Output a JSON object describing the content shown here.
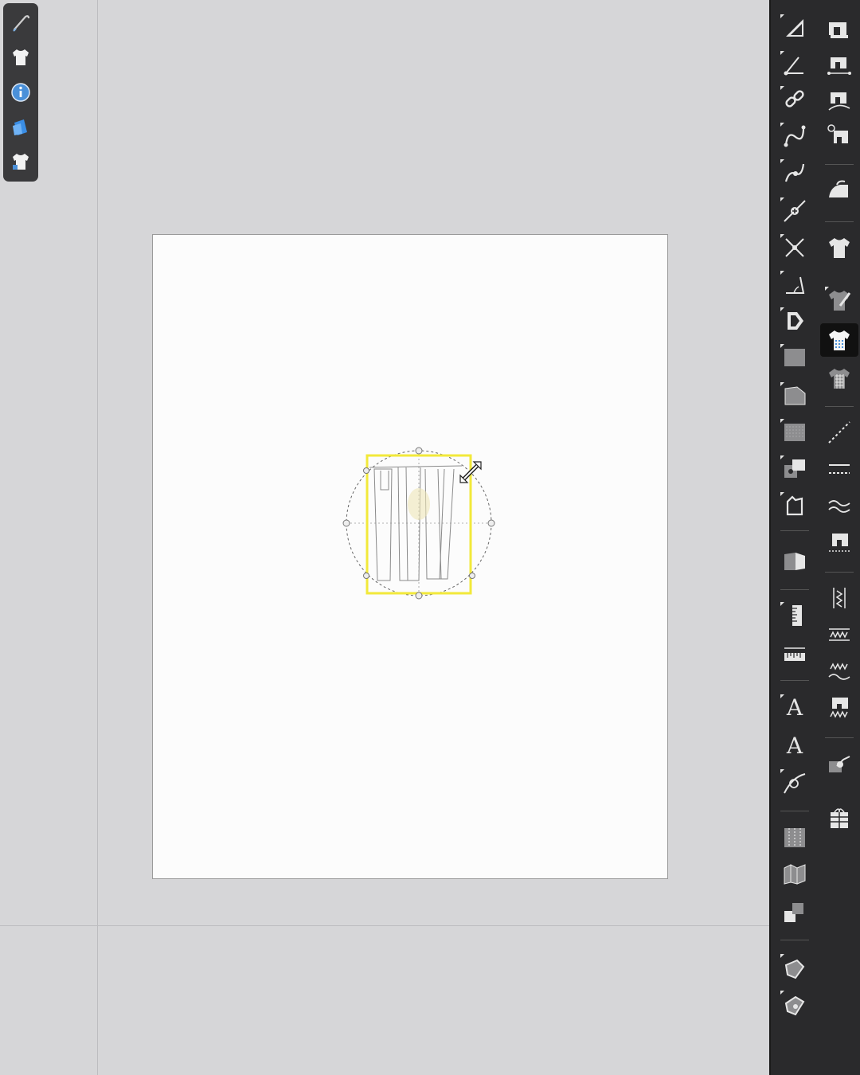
{
  "left_palette": {
    "tools": [
      {
        "icon": "needle-icon"
      },
      {
        "icon": "tshirt-icon"
      },
      {
        "icon": "info-icon"
      },
      {
        "icon": "fabric-swatch-icon"
      },
      {
        "icon": "garment-library-icon"
      }
    ]
  },
  "right_toolbar": {
    "column_a": [
      {
        "icon": "triangle-ruler-icon"
      },
      {
        "icon": "angle-point-icon"
      },
      {
        "icon": "link-icon"
      },
      {
        "icon": "curve-icon"
      },
      {
        "icon": "curve-point-icon"
      },
      {
        "icon": "add-point-icon"
      },
      {
        "icon": "intersect-icon"
      },
      {
        "icon": "angle-measure-icon"
      },
      {
        "icon": "rotate-piece-icon"
      },
      {
        "icon": "rectangle-piece-icon"
      },
      {
        "icon": "polygon-piece-icon"
      },
      {
        "icon": "textured-piece-icon"
      },
      {
        "icon": "overlap-pieces-icon"
      },
      {
        "icon": "notch-piece-icon"
      },
      {
        "icon": "fold-piece-icon"
      },
      {
        "icon": "vertical-ruler-icon"
      },
      {
        "icon": "horizontal-ruler-icon"
      },
      {
        "icon": "text-tool-icon",
        "text": "A"
      },
      {
        "icon": "text-style-icon",
        "text": "A"
      },
      {
        "icon": "text-on-path-icon"
      },
      {
        "icon": "pleat-icon"
      },
      {
        "icon": "zigzag-fold-icon"
      },
      {
        "icon": "stack-pieces-icon"
      },
      {
        "icon": "seam-allowance-icon"
      },
      {
        "icon": "seam-corner-icon"
      }
    ],
    "column_b": [
      {
        "icon": "sewing-machine-icon"
      },
      {
        "icon": "sewing-measure-icon"
      },
      {
        "icon": "sewing-curve-icon"
      },
      {
        "icon": "sewing-search-icon"
      },
      {
        "icon": "iron-icon"
      },
      {
        "icon": "tshirt-icon"
      },
      {
        "icon": "brush-garment-icon"
      },
      {
        "icon": "pattern-fill-garment-icon",
        "active": true
      },
      {
        "icon": "checker-garment-icon"
      },
      {
        "icon": "dashed-line-icon"
      },
      {
        "icon": "double-stitch-icon"
      },
      {
        "icon": "wave-stitch-icon"
      },
      {
        "icon": "stitch-machine-icon"
      },
      {
        "icon": "zigzag-vertical-icon"
      },
      {
        "icon": "zigzag-horizontal-icon"
      },
      {
        "icon": "zigzag-wave-icon"
      },
      {
        "icon": "machine-zigzag-icon"
      },
      {
        "icon": "fabric-link-icon"
      },
      {
        "icon": "gift-box-icon"
      }
    ]
  },
  "colors": {
    "background": "#d6d6d8",
    "toolbar": "#2a2a2c",
    "selection": "#f2e93a",
    "artboard": "#fcfcfc"
  }
}
